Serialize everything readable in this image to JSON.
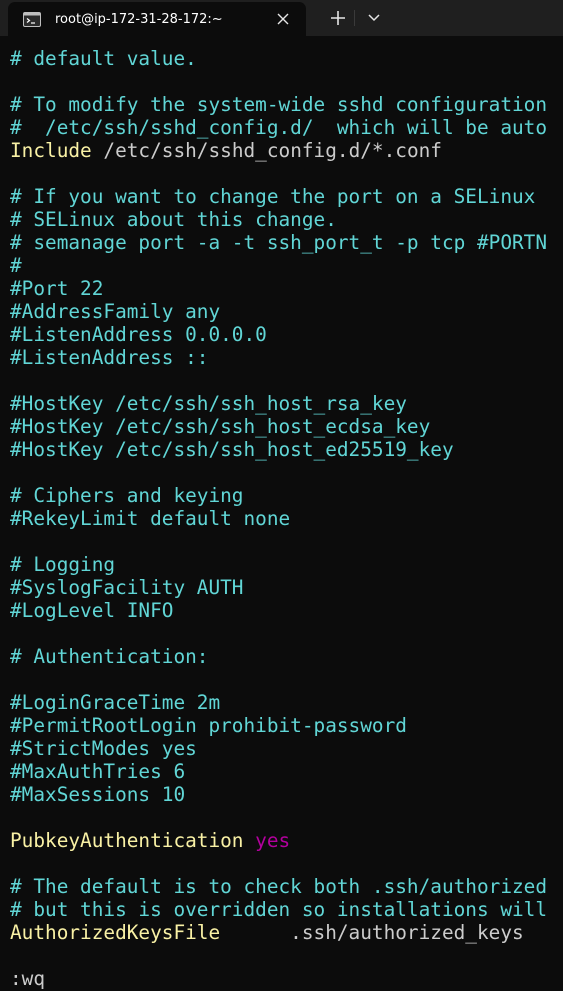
{
  "window": {
    "tab_title": "root@ip-172-31-28-172:~",
    "tab_icon": "terminal-icon",
    "close_icon": "close-icon",
    "new_tab_icon": "plus-icon",
    "dropdown_icon": "chevron-down-icon"
  },
  "colors": {
    "background": "#0c0c0c",
    "titlebar": "#1f1f1f",
    "comment": "#61d6d6",
    "keyword": "#f9f1a5",
    "value": "#b4009e",
    "text": "#cccccc"
  },
  "editor": {
    "lines": [
      {
        "type": "comment",
        "text": "# default value."
      },
      {
        "type": "blank",
        "text": ""
      },
      {
        "type": "comment",
        "text": "# To modify the system-wide sshd configuration"
      },
      {
        "type": "comment",
        "text": "#  /etc/ssh/sshd_config.d/  which will be auto"
      },
      {
        "type": "include",
        "keyword": "Include",
        "path_before": " /etc/ssh/sshd_config.d/",
        "star": "*",
        "path_after": ".conf"
      },
      {
        "type": "blank",
        "text": ""
      },
      {
        "type": "comment",
        "text": "# If you want to change the port on a SELinux"
      },
      {
        "type": "comment",
        "text": "# SELinux about this change."
      },
      {
        "type": "comment",
        "text": "# semanage port -a -t ssh_port_t -p tcp #PORTN"
      },
      {
        "type": "comment",
        "text": "#"
      },
      {
        "type": "comment",
        "text": "#Port 22"
      },
      {
        "type": "comment",
        "text": "#AddressFamily any"
      },
      {
        "type": "comment",
        "text": "#ListenAddress 0.0.0.0"
      },
      {
        "type": "comment",
        "text": "#ListenAddress ::"
      },
      {
        "type": "blank",
        "text": ""
      },
      {
        "type": "comment",
        "text": "#HostKey /etc/ssh/ssh_host_rsa_key"
      },
      {
        "type": "comment",
        "text": "#HostKey /etc/ssh/ssh_host_ecdsa_key"
      },
      {
        "type": "comment",
        "text": "#HostKey /etc/ssh/ssh_host_ed25519_key"
      },
      {
        "type": "blank",
        "text": ""
      },
      {
        "type": "comment",
        "text": "# Ciphers and keying"
      },
      {
        "type": "comment",
        "text": "#RekeyLimit default none"
      },
      {
        "type": "blank",
        "text": ""
      },
      {
        "type": "comment",
        "text": "# Logging"
      },
      {
        "type": "comment",
        "text": "#SyslogFacility AUTH"
      },
      {
        "type": "comment",
        "text": "#LogLevel INFO"
      },
      {
        "type": "blank",
        "text": ""
      },
      {
        "type": "comment",
        "text": "# Authentication:"
      },
      {
        "type": "blank",
        "text": ""
      },
      {
        "type": "comment",
        "text": "#LoginGraceTime 2m"
      },
      {
        "type": "comment",
        "text": "#PermitRootLogin prohibit-password"
      },
      {
        "type": "comment",
        "text": "#StrictModes yes"
      },
      {
        "type": "comment",
        "text": "#MaxAuthTries 6"
      },
      {
        "type": "comment",
        "text": "#MaxSessions 10"
      },
      {
        "type": "blank",
        "text": ""
      },
      {
        "type": "setting",
        "keyword": "PubkeyAuthentication",
        "value": " yes"
      },
      {
        "type": "blank",
        "text": ""
      },
      {
        "type": "comment",
        "text": "# The default is to check both .ssh/authorized"
      },
      {
        "type": "comment",
        "text": "# but this is overridden so installations will"
      },
      {
        "type": "setting_plain",
        "keyword": "AuthorizedKeysFile",
        "value": "      .ssh/authorized_keys"
      },
      {
        "type": "blank",
        "text": ""
      },
      {
        "type": "command",
        "text": ":wq"
      }
    ]
  }
}
